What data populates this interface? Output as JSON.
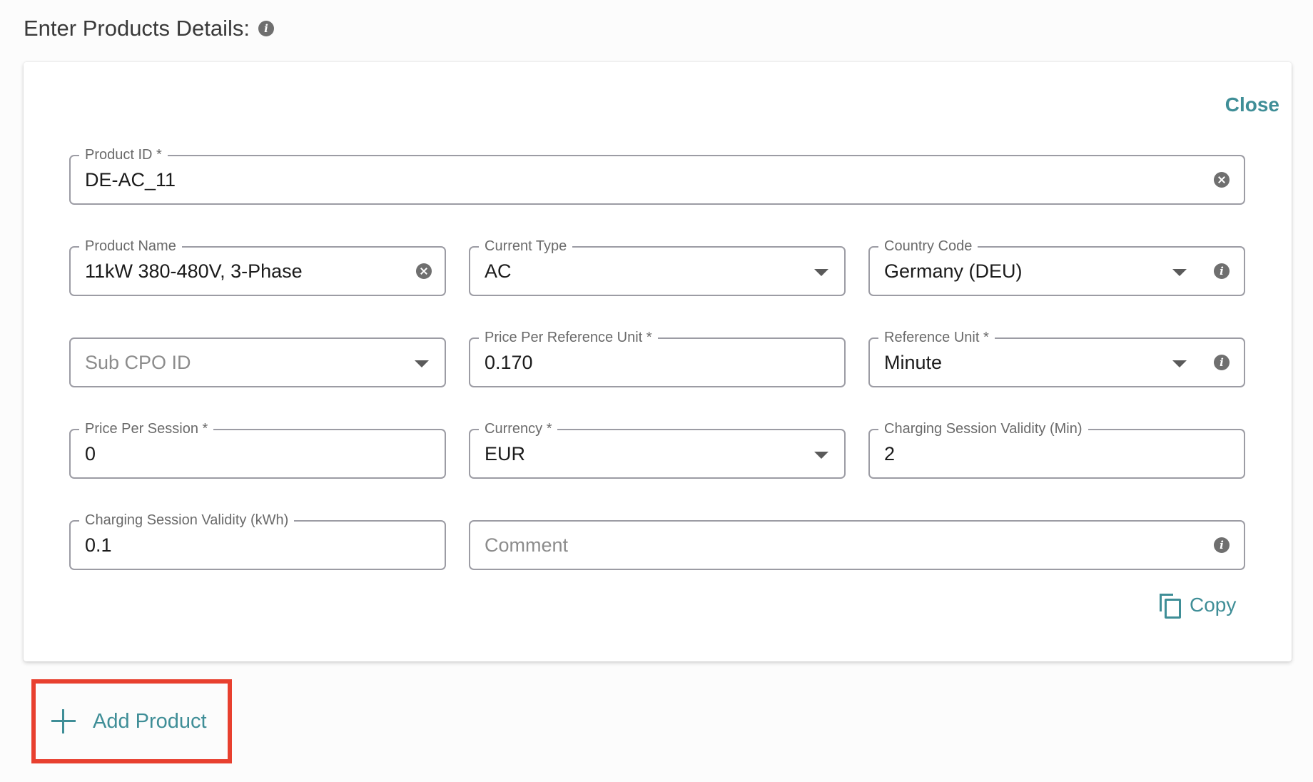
{
  "section": {
    "title": "Enter Products Details:"
  },
  "card": {
    "close_label": "Close",
    "copy_label": "Copy"
  },
  "fields": {
    "product_id": {
      "label": "Product ID *",
      "value": "DE-AC_11"
    },
    "product_name": {
      "label": "Product Name",
      "value": "11kW 380-480V, 3-Phase"
    },
    "current_type": {
      "label": "Current Type",
      "value": "AC"
    },
    "country_code": {
      "label": "Country Code",
      "value": "Germany (DEU)"
    },
    "sub_cpo_id": {
      "placeholder": "Sub CPO ID"
    },
    "price_per_reference_unit": {
      "label": "Price Per Reference Unit *",
      "value": "0.170"
    },
    "reference_unit": {
      "label": "Reference Unit *",
      "value": "Minute"
    },
    "price_per_session": {
      "label": "Price Per Session *",
      "value": "0"
    },
    "currency": {
      "label": "Currency *",
      "value": "EUR"
    },
    "validity_min": {
      "label": "Charging Session Validity (Min)",
      "value": "2"
    },
    "validity_kwh": {
      "label": "Charging Session Validity (kWh)",
      "value": "0.1"
    },
    "comment": {
      "placeholder": "Comment"
    }
  },
  "add_product": {
    "label": "Add Product"
  },
  "icons": {
    "info": "info-icon",
    "clear": "clear-icon",
    "dropdown": "chevron-down-icon",
    "copy": "copy-icon",
    "plus": "plus-icon"
  },
  "colors": {
    "accent": "#3f8e97",
    "highlight_border": "#e8402f",
    "field_border": "#9c9ca4"
  }
}
